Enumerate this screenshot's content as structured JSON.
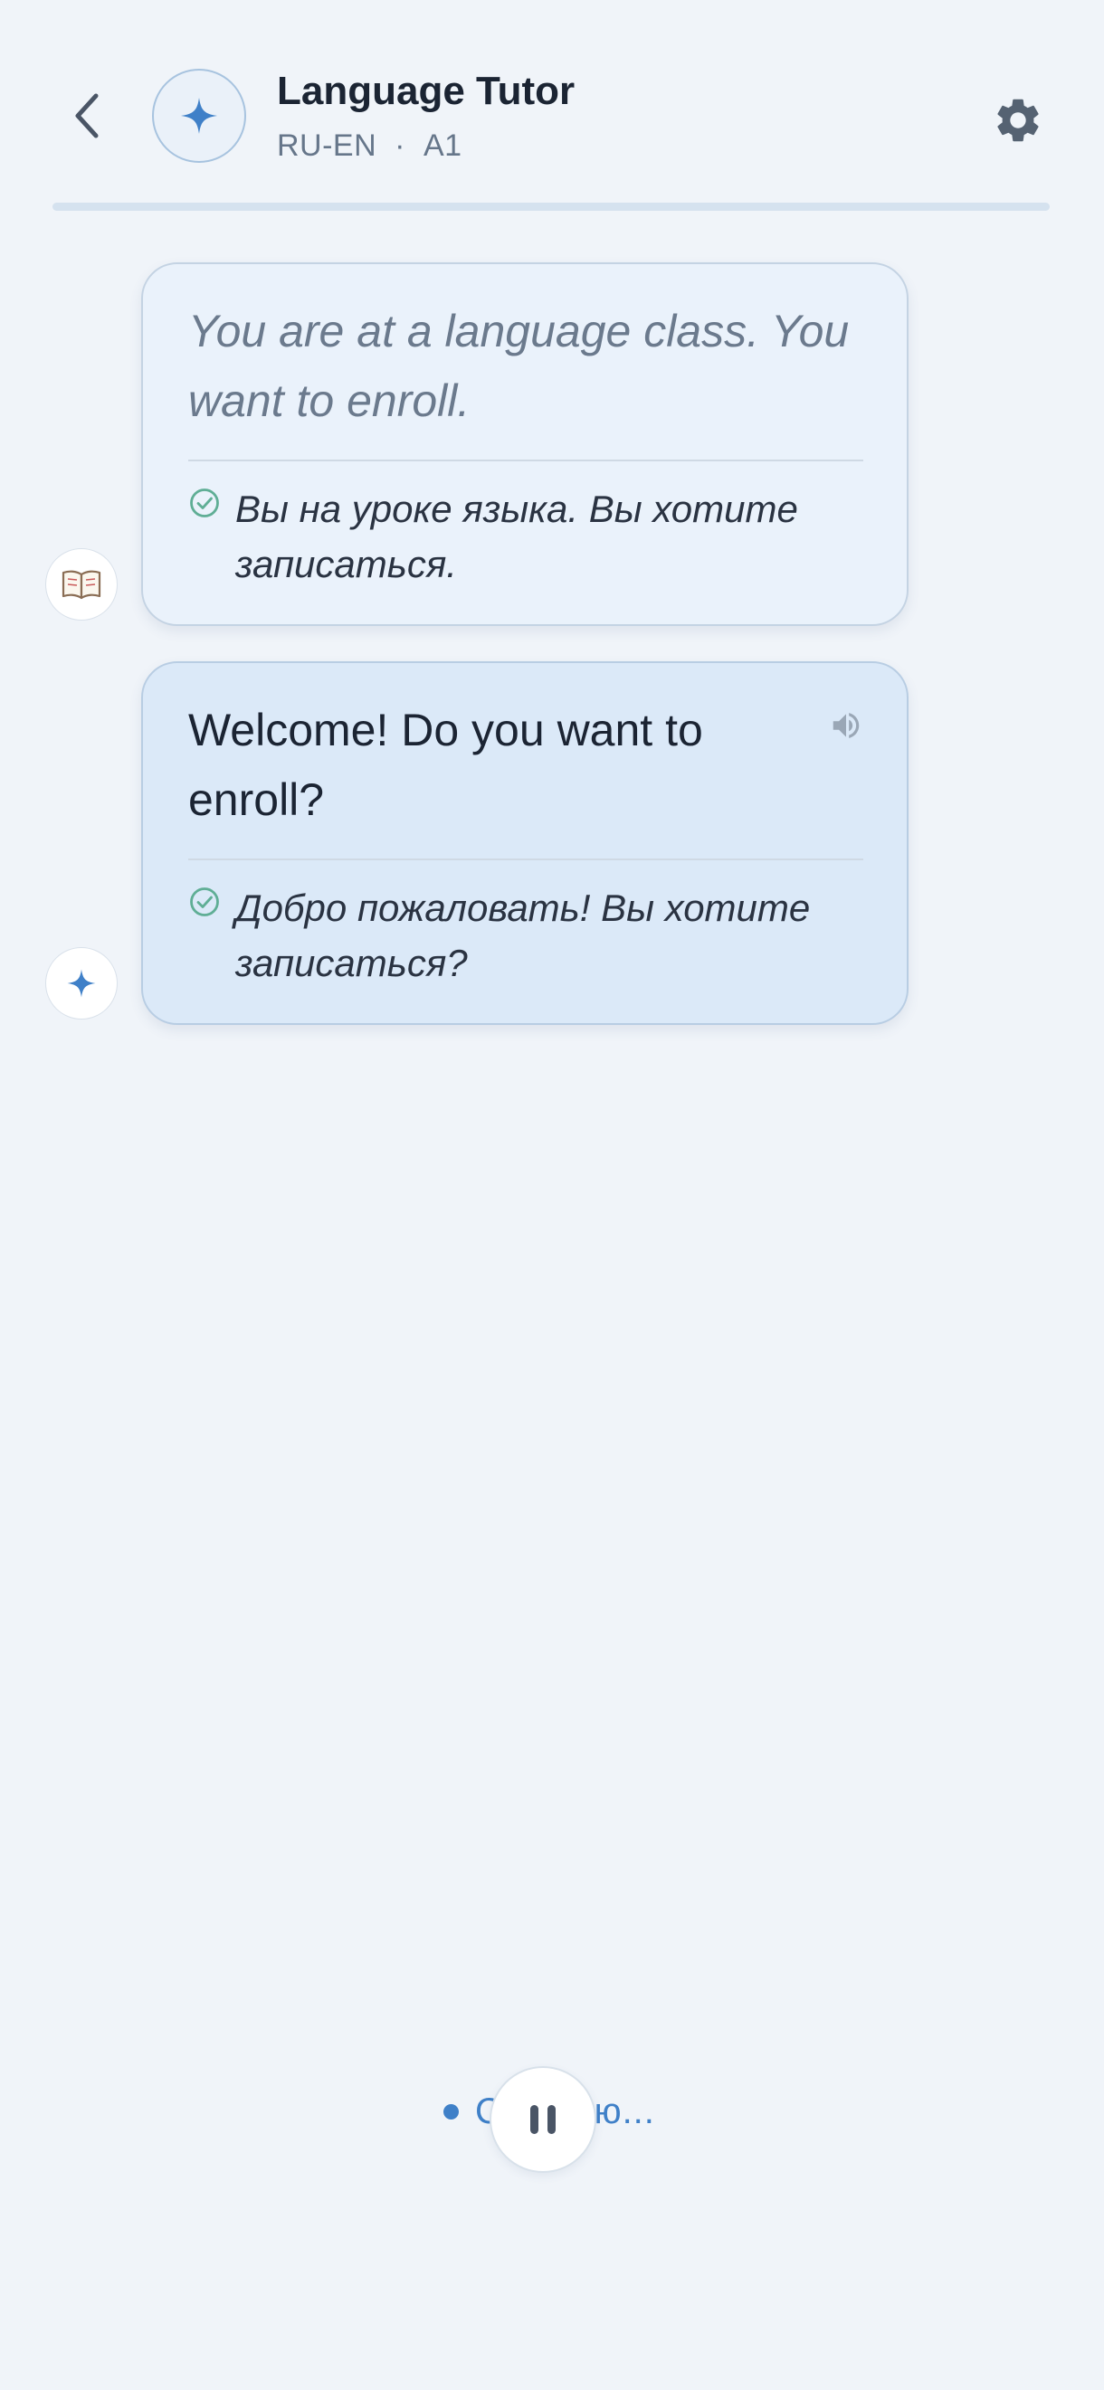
{
  "header": {
    "back_icon": "chevron-left-icon",
    "avatar_icon": "sparkle-icon",
    "title": "Language Tutor",
    "language_pair": "RU-EN",
    "separator": "·",
    "level": "A1",
    "settings_icon": "gear-icon",
    "lesson_progress_percent": 0
  },
  "messages": [
    {
      "role": "context",
      "avatar_icon": "open-book-icon",
      "text": "You are at a language class. You want to enroll.",
      "translation": "Вы на уроке языка. Вы хотите записаться.",
      "status_icon": "check-circle-icon"
    },
    {
      "role": "tutor",
      "avatar_icon": "sparkle-icon",
      "text": "Welcome! Do you want to enroll?",
      "translation": "Добро пожаловать! Вы хотите записаться?",
      "status_icon": "check-circle-icon",
      "audio_icon": "speaker-icon"
    }
  ],
  "footer": {
    "status_text": "Слушаю...",
    "pause_icon": "pause-icon"
  },
  "colors": {
    "background": "#f0f4f9",
    "accent": "#3f80c8",
    "check": "#5fae95",
    "tutor_bubble": "#dbe9f8",
    "context_bubble": "#eaf2fb"
  }
}
